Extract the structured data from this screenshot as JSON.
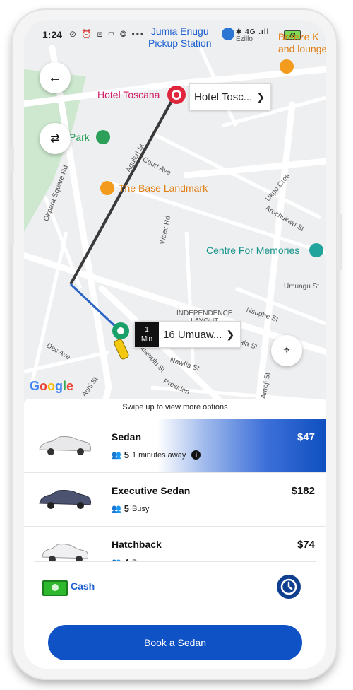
{
  "status_bar": {
    "time": "1:24",
    "icons": "⊘ ⏰ ⧆ ▭ ◎ •••",
    "right_icons": "✱ 4G .ıll",
    "battery": "73"
  },
  "map": {
    "poi_labels": {
      "jumia": "Jumia Enugu\nPickup Station",
      "breeze": "Breeze K\nand lounge",
      "hotel_toscana": "Hotel Toscana",
      "park": "Park",
      "base_landmark": "The Base Landmark",
      "centre": "Centre For Memories",
      "independence": "INDEPENDENCE\nLAYOUT",
      "ezillo": "Ezillo"
    },
    "streets": {
      "okpara": "Okpara Square Rd",
      "court": "Court Ave",
      "aguleri": "Aguleri St",
      "waec": "Waec Rd",
      "ukpo": "Ukpo Cres",
      "arochukwu": "Arochukwu St",
      "umuagu": "Umuagu St",
      "nsugbe": "Nsugbe St",
      "obiala": "Obiala St",
      "nawfia": "Nawfia St",
      "presidential": "Presiden",
      "dec": "Dec Ave",
      "achi": "Achi St",
      "amuawulu": "Amuawulu St",
      "amoji": "Amoji St"
    },
    "destination_callout": "Hotel Tosc...",
    "pickup_callout": "16 Umuaw...",
    "eta_value": "1",
    "eta_unit": "Min",
    "google": "Google",
    "colors": {
      "route_dark": "#3a3a3a",
      "route_blue": "#2b63c6",
      "dest_pin": "#e0263c",
      "pickup_pin": "#1aa06a"
    }
  },
  "sheet": {
    "swipe_hint": "Swipe up to view more options",
    "rides": [
      {
        "name": "Sedan",
        "seats": "5",
        "status": "1 minutes away",
        "price": "$47",
        "selected": true
      },
      {
        "name": "Executive Sedan",
        "seats": "5",
        "status": "Busy",
        "price": "$182",
        "selected": false
      },
      {
        "name": "Hatchback",
        "seats": "4",
        "status": "Busy",
        "price": "$74",
        "selected": false
      }
    ],
    "payment_method": "Cash",
    "book_button": "Book a Sedan",
    "colors": {
      "primary": "#0f52c6",
      "clock": "#0f3f8f",
      "cash_text": "#1d5fcf"
    }
  }
}
